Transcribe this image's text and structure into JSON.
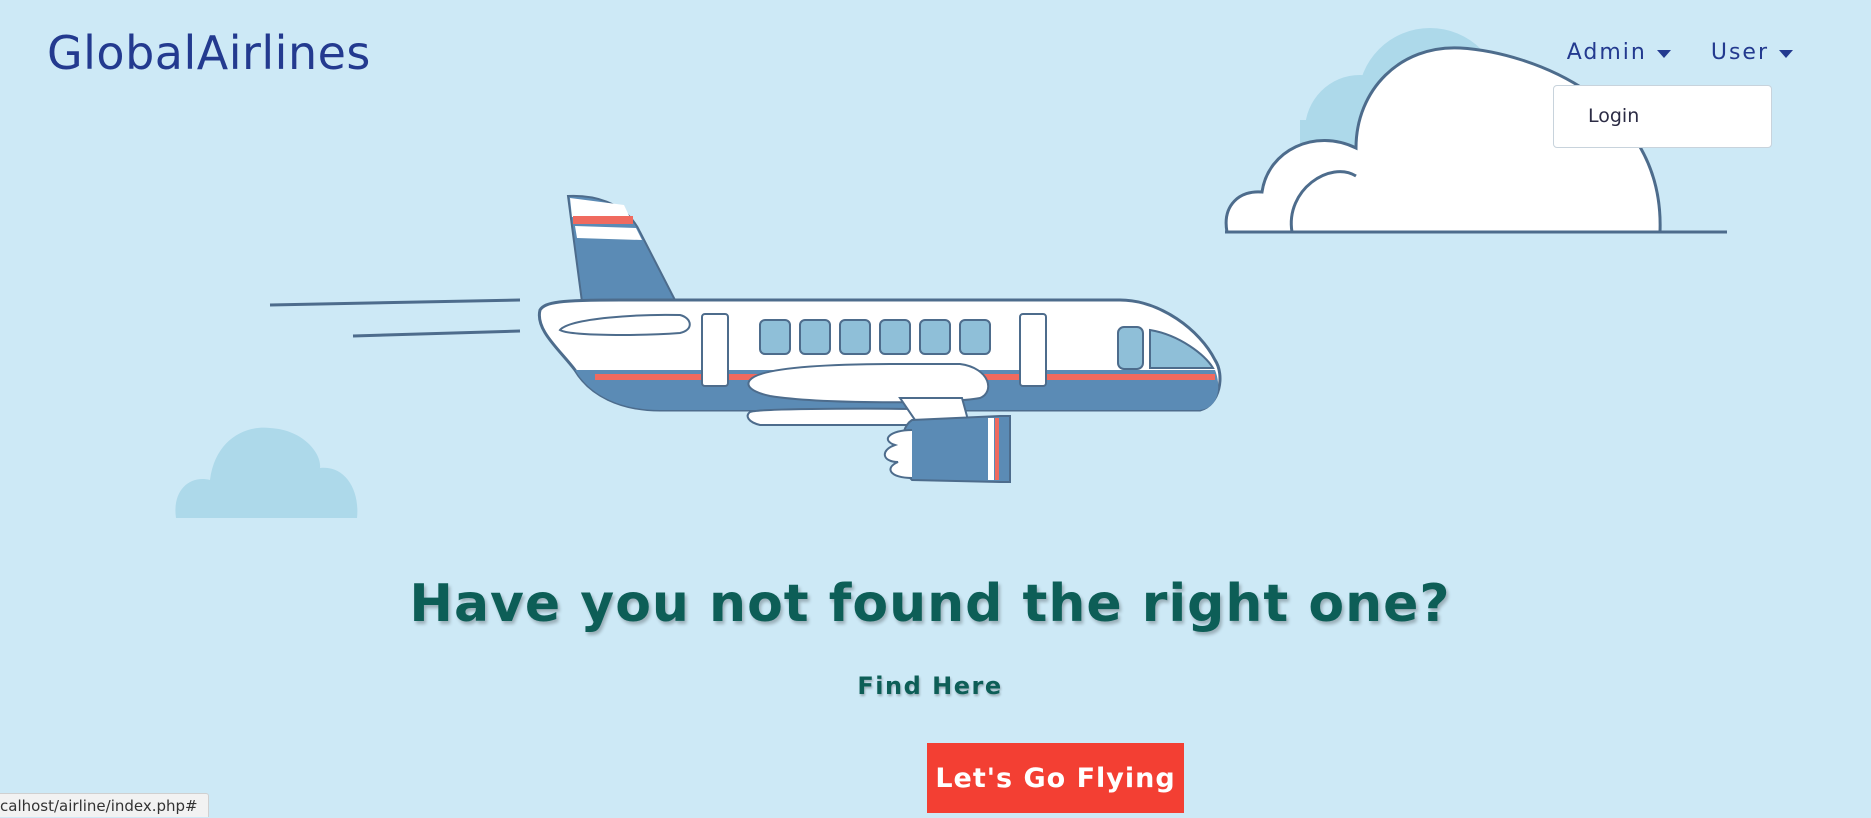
{
  "brand": {
    "name": "GlobalAirlines"
  },
  "nav": {
    "admin_label": "Admin",
    "user_label": "User"
  },
  "dropdown": {
    "login_label": "Login"
  },
  "hero": {
    "headline": "Have you not found the right one?",
    "subhead": "Find Here",
    "cta_label": "Let's Go Flying"
  },
  "status_bar": {
    "url": "calhost/airline/index.php#"
  },
  "icons": {
    "admin_caret": "caret-down-icon",
    "user_caret": "caret-down-icon",
    "illustration": "airplane-illustration"
  },
  "colors": {
    "background": "#cde9f6",
    "brand": "#233a8f",
    "headline": "#0d5e57",
    "cta": "#f33f33"
  }
}
